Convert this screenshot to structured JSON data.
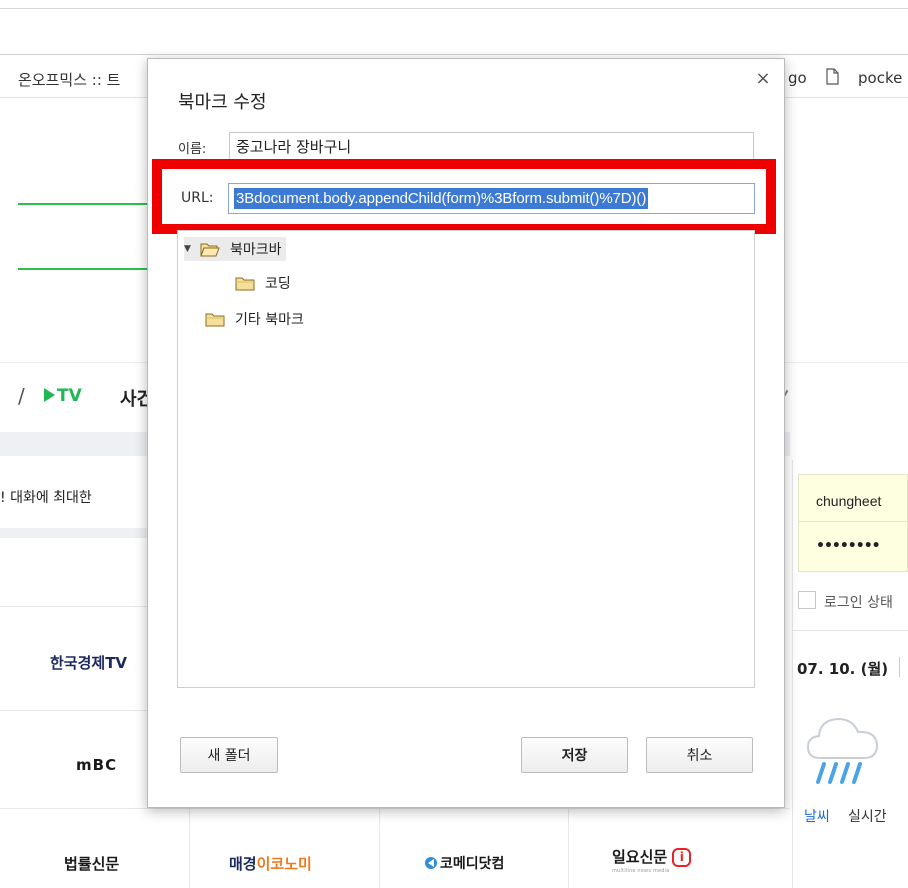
{
  "background": {
    "bookmark_bar": {
      "left_item": "온오프믹스 :: 트",
      "right_item_1": "go",
      "right_item_2": "pocke"
    },
    "nav": {
      "slash": "/",
      "tv_label": "TV",
      "next_label": "사건"
    },
    "news_snippet": "! 대화에 최대한",
    "logos": {
      "hankyung_tv": "한국경제TV",
      "mbc": "mBC",
      "lawtimes": "법률신문",
      "mk_economy_a": "매경",
      "mk_economy_b": "이코노미",
      "comedy": "코메디닷컴",
      "ilyo": "일요신문",
      "ilyo_badge": "i",
      "ilyo_sub": "multiline news media"
    },
    "login": {
      "username": "chungheet",
      "password": "••••••••",
      "keep_label": "로그인 상태"
    },
    "date_label": "07. 10. (월)",
    "weather_link": "날씨",
    "weather_live": "실시간"
  },
  "dialog": {
    "title": "북마크 수정",
    "close_glyph": "×",
    "name_label": "이름:",
    "name_value": "중고나라 장바구니",
    "url_label": "URL:",
    "url_value": "3Bdocument.body.appendChild(form)%3Bform.submit()%7D)()",
    "tree": [
      {
        "label": "북마크바",
        "expanded": true,
        "selected": true
      },
      {
        "label": "코딩",
        "expanded": false,
        "selected": false
      },
      {
        "label": "기타 북마크",
        "expanded": false,
        "selected": false
      }
    ],
    "new_folder_button": "새 폴더",
    "save_button": "저장",
    "cancel_button": "취소"
  },
  "colors": {
    "highlight_frame": "#ee0000",
    "url_selection": "#3d7ad4",
    "accent_green": "#2ac14c",
    "folder_fill": "#f5df9b"
  }
}
